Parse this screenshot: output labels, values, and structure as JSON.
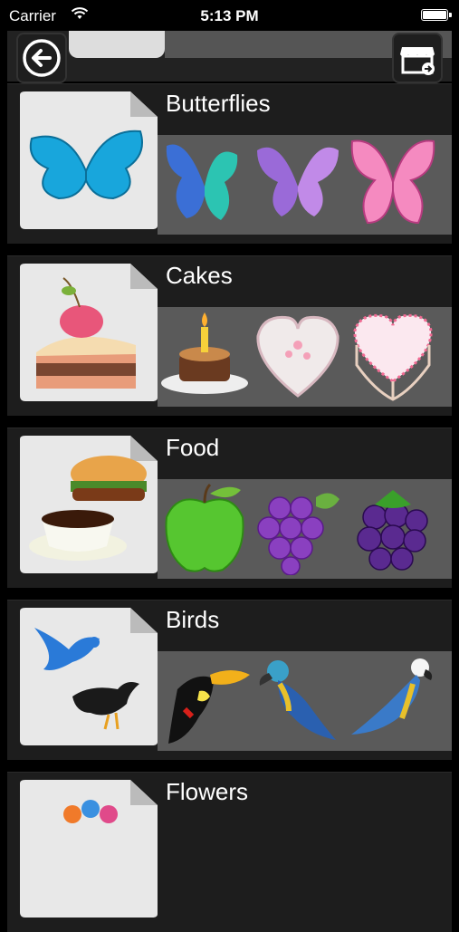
{
  "status_bar": {
    "carrier": "Carrier",
    "time": "5:13 PM"
  },
  "categories": [
    {
      "label": "Butterflies",
      "preview": [
        "blue-butterfly",
        "purple-butterfly",
        "pink-butterfly"
      ]
    },
    {
      "label": "Cakes",
      "preview": [
        "birthday-cake",
        "white-heart-cake",
        "pink-heart-cake"
      ]
    },
    {
      "label": "Food",
      "preview": [
        "green-apple",
        "purple-grapes",
        "blackberry"
      ]
    },
    {
      "label": "Birds",
      "preview": [
        "toucan",
        "blue-parrot",
        "macaw"
      ]
    },
    {
      "label": "Flowers",
      "preview": []
    }
  ],
  "colors": {
    "background": "#000000",
    "card": "#1d1d1d",
    "strip": "#5a5a5a"
  }
}
